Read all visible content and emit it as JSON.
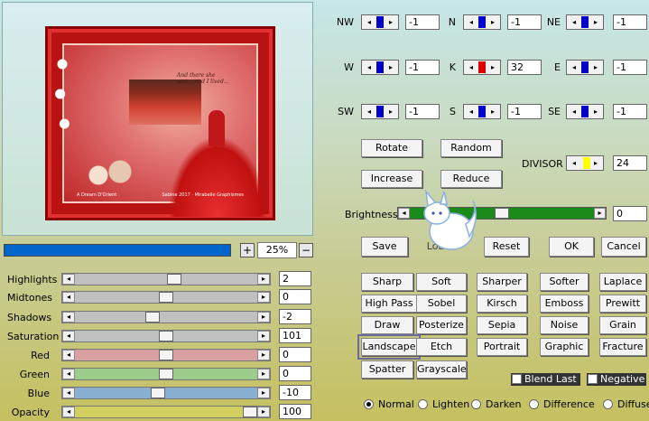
{
  "preview": {
    "art_caption_left": "A Dream D'Orient",
    "art_caption_right": "Sabine 2017 · Mirabelle Graphismes",
    "art_script": "And there she was… and I lived…"
  },
  "progress": {
    "value": 1.0,
    "color": "#0066cc"
  },
  "zoom": {
    "plus": "+",
    "value": "25%",
    "minus": "−"
  },
  "adjustments": [
    {
      "label": "Highlights",
      "value": "2",
      "track_color": "#c0c0c0",
      "position": 0.55
    },
    {
      "label": "Midtones",
      "value": "0",
      "track_color": "#c0c0c0",
      "position": 0.5
    },
    {
      "label": "Shadows",
      "value": "-2",
      "track_color": "#c0c0c0",
      "position": 0.42
    },
    {
      "label": "Saturation",
      "value": "101",
      "track_color": "#c0c0c0",
      "position": 0.5
    },
    {
      "label": "Red",
      "value": "0",
      "track_color": "#d8a0a0",
      "position": 0.5
    },
    {
      "label": "Green",
      "value": "0",
      "track_color": "#9ccc8a",
      "position": 0.5
    },
    {
      "label": "Blue",
      "value": "-10",
      "track_color": "#88aed0",
      "position": 0.45
    },
    {
      "label": "Opacity",
      "value": "100",
      "track_color": "#d4d060",
      "position": 1.0
    }
  ],
  "matrix": {
    "NW": {
      "label": "NW",
      "value": "-1",
      "marker": "#0000cc"
    },
    "N": {
      "label": "N",
      "value": "-1",
      "marker": "#0000cc"
    },
    "NE": {
      "label": "NE",
      "value": "-1",
      "marker": "#0000cc"
    },
    "W": {
      "label": "W",
      "value": "-1",
      "marker": "#0000cc"
    },
    "K": {
      "label": "K",
      "value": "32",
      "marker": "#dd0000"
    },
    "E": {
      "label": "E",
      "value": "-1",
      "marker": "#0000cc"
    },
    "SW": {
      "label": "SW",
      "value": "-1",
      "marker": "#0000cc"
    },
    "S": {
      "label": "S",
      "value": "-1",
      "marker": "#0000cc"
    },
    "SE": {
      "label": "SE",
      "value": "-1",
      "marker": "#0000cc"
    }
  },
  "buttons": {
    "rotate": "Rotate",
    "random": "Random",
    "increase": "Increase",
    "reduce": "Reduce",
    "save": "Save",
    "load": "Load",
    "reset": "Reset",
    "ok": "OK",
    "cancel": "Cancel"
  },
  "divisor": {
    "label": "DIVISOR",
    "value": "24",
    "marker": "#ffff00"
  },
  "brightness": {
    "label": "Brightness",
    "value": "0",
    "position": 0.5,
    "track_color": "#1a8a1a"
  },
  "presets": [
    [
      "Sharp",
      "Soft",
      "Sharper",
      "Softer",
      "Laplace"
    ],
    [
      "High Pass",
      "Sobel",
      "Kirsch",
      "Emboss",
      "Prewitt"
    ],
    [
      "Draw",
      "Posterize",
      "Sepia",
      "Noise",
      "Grain"
    ],
    [
      "Landscape",
      "Etch",
      "Portrait",
      "Graphic",
      "Fracture"
    ],
    [
      "Spatter",
      "Grayscale"
    ]
  ],
  "selected_preset": "Landscape",
  "options": {
    "blend_last": "Blend Last",
    "negative": "Negative"
  },
  "blend_modes": {
    "selected": "Normal",
    "items": [
      "Normal",
      "Lighten",
      "Darken",
      "Difference",
      "Diffuse"
    ]
  },
  "icons": {
    "arrow_left": "◂",
    "arrow_right": "▸"
  }
}
